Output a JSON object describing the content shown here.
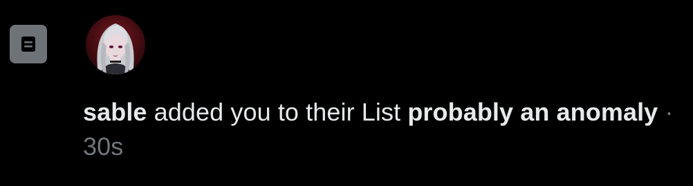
{
  "notification": {
    "icon": "list-icon",
    "avatar": "avatar-icon",
    "username": "sable",
    "action_text": " added you to their List ",
    "list_name": "probably an anomaly",
    "separator": " · ",
    "timestamp": "30s"
  },
  "colors": {
    "background": "#000000",
    "text": "#e7e9ea",
    "muted": "#71767b",
    "icon_bg": "#6e7378"
  }
}
